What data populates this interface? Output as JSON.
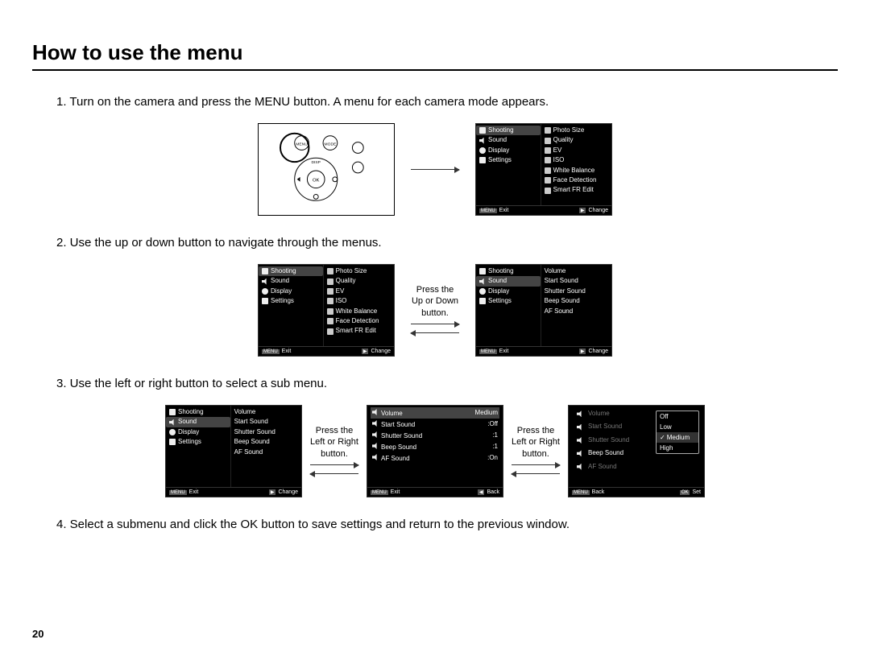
{
  "title": "How to use the menu",
  "steps": {
    "s1": "1. Turn on the camera and press the MENU button. A menu for each camera mode appears.",
    "s2": "2. Use the up or down button to navigate through the menus.",
    "s3": "3. Use the left or right button to select a sub menu.",
    "s4": "4. Select a submenu and click the OK button to save settings and return to the previous window."
  },
  "arrows": {
    "updown": "Press the\nUp or Down\nbutton.",
    "leftright": "Press the\nLeft or Right\nbutton."
  },
  "camera_labels": {
    "menu": "MENU",
    "mode": "MODE",
    "disp": "DISP",
    "ok": "OK"
  },
  "left_tabs": {
    "shooting": "Shooting",
    "sound": "Sound",
    "display": "Display",
    "settings": "Settings"
  },
  "shooting_items": {
    "photo_size": "Photo Size",
    "quality": "Quality",
    "ev": "EV",
    "iso": "ISO",
    "wb": "White Balance",
    "face": "Face Detection",
    "smart": "Smart FR Edit"
  },
  "sound_items": {
    "volume": "Volume",
    "start": "Start Sound",
    "shutter": "Shutter Sound",
    "beep": "Beep Sound",
    "af": "AF Sound"
  },
  "sound_values": {
    "volume": "Medium",
    "start": ":Off",
    "shutter": ":1",
    "beep": ":1",
    "af": ":On"
  },
  "volume_options": {
    "off": "Off",
    "low": "Low",
    "medium": "Medium",
    "high": "High"
  },
  "footer": {
    "menu": "MENU",
    "exit": "Exit",
    "change": "Change",
    "back": "Back",
    "set": "Set"
  },
  "page": "20"
}
